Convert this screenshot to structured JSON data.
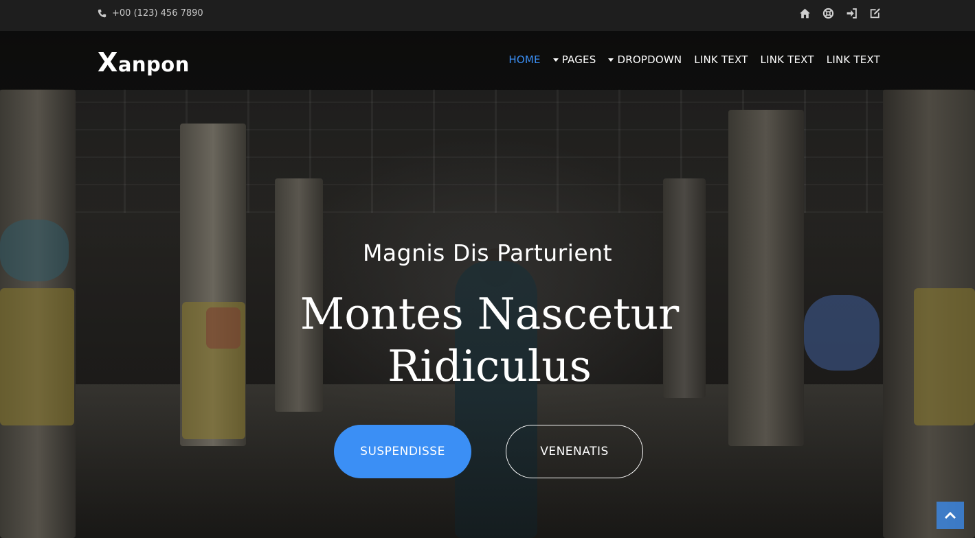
{
  "topbar": {
    "phone": "+00 (123) 456 7890",
    "icons": [
      "home-icon",
      "life-ring-icon",
      "sign-in-icon",
      "edit-icon"
    ]
  },
  "navbar": {
    "brand_first": "X",
    "brand_rest": "anpon",
    "items": [
      {
        "label": "HOME",
        "active": true,
        "dropdown": false
      },
      {
        "label": "PAGES",
        "active": false,
        "dropdown": true
      },
      {
        "label": "DROPDOWN",
        "active": false,
        "dropdown": true
      },
      {
        "label": "LINK TEXT",
        "active": false,
        "dropdown": false
      },
      {
        "label": "LINK TEXT",
        "active": false,
        "dropdown": false
      },
      {
        "label": "LINK TEXT",
        "active": false,
        "dropdown": false
      }
    ]
  },
  "hero": {
    "subtitle": "Magnis Dis Parturient",
    "title_line1": "Montes Nascetur",
    "title_line2": "Ridiculus",
    "primary_button": "SUSPENDISSE",
    "secondary_button": "VENENATIS"
  },
  "colors": {
    "accent": "#3b8ff5",
    "topbar": "#1e1e1e"
  },
  "scroll_top_icon": "chevron-up-icon"
}
